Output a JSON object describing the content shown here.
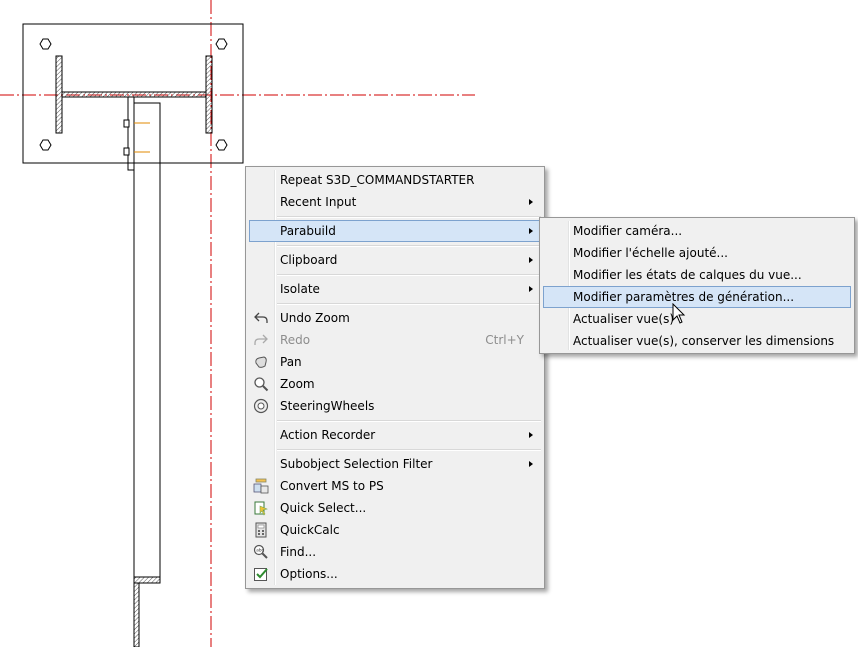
{
  "context_menu": {
    "items": [
      {
        "label": "Repeat S3D_COMMANDSTARTER"
      },
      {
        "label": "Recent Input"
      },
      {
        "label": "Parabuild"
      },
      {
        "label": "Clipboard"
      },
      {
        "label": "Isolate"
      },
      {
        "label": "Undo Zoom"
      },
      {
        "label": "Redo",
        "shortcut": "Ctrl+Y"
      },
      {
        "label": "Pan"
      },
      {
        "label": "Zoom"
      },
      {
        "label": "SteeringWheels"
      },
      {
        "label": "Action Recorder"
      },
      {
        "label": "Subobject Selection Filter"
      },
      {
        "label": "Convert MS to PS"
      },
      {
        "label": "Quick Select..."
      },
      {
        "label": "QuickCalc"
      },
      {
        "label": "Find..."
      },
      {
        "label": "Options..."
      }
    ]
  },
  "submenu": {
    "items": [
      {
        "label": "Modifier caméra..."
      },
      {
        "label": "Modifier l'échelle ajouté..."
      },
      {
        "label": "Modifier les états de calques du vue..."
      },
      {
        "label": "Modifier paramètres de génération..."
      },
      {
        "label": "Actualiser vue(s)"
      },
      {
        "label": "Actualiser vue(s), conserver les dimensions"
      }
    ]
  },
  "colors": {
    "centerline": "#d00000",
    "highlight": "#d5e5f7",
    "highlight_border": "#7da2ce",
    "menu_bg": "#f0f0f0"
  }
}
